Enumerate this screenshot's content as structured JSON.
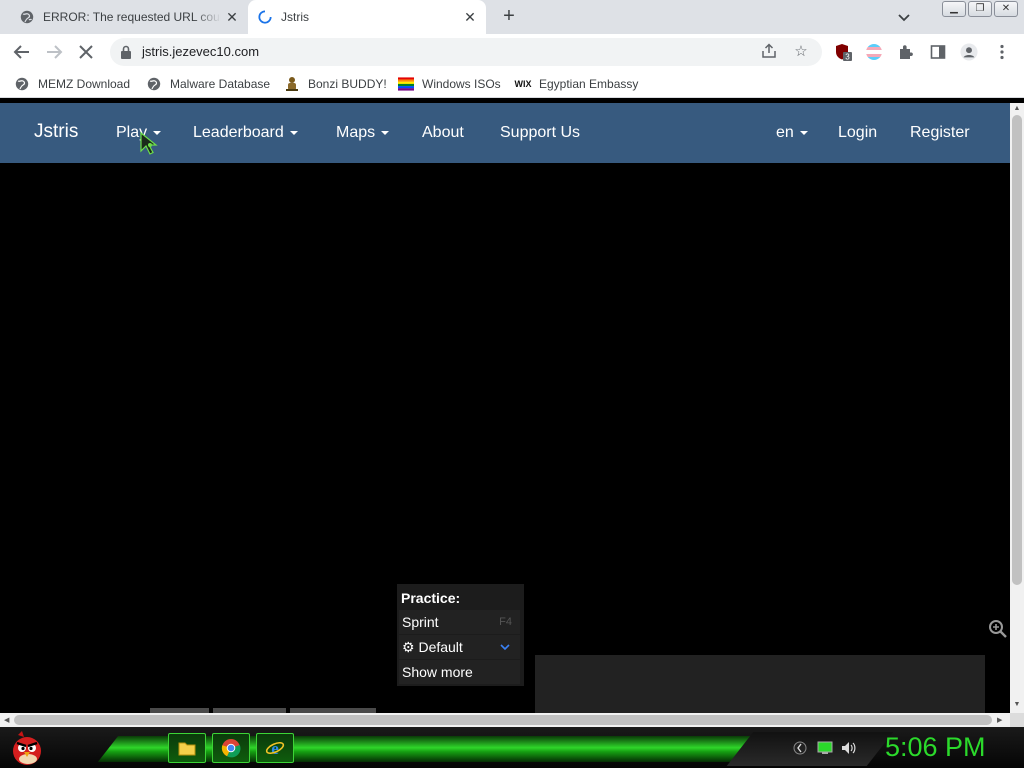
{
  "browser": {
    "tabs": [
      {
        "title": "ERROR: The requested URL could not be retrieved",
        "active": false
      },
      {
        "title": "Jstris",
        "active": true
      }
    ],
    "url": "jstris.jezevec10.com",
    "bookmarks": [
      {
        "label": "MEMZ Download",
        "icon": "globe-icon"
      },
      {
        "label": "Malware Database",
        "icon": "globe-icon"
      },
      {
        "label": "Bonzi BUDDY!",
        "icon": "bonzi-icon"
      },
      {
        "label": "Windows ISOs",
        "icon": "rainbow-flag-icon"
      },
      {
        "label": "Egyptian Embassy",
        "icon": "wix-icon"
      }
    ],
    "extension_badge": "3",
    "window_buttons": [
      "minimize",
      "restore",
      "close"
    ]
  },
  "site": {
    "brand": "Jstris",
    "nav": [
      {
        "label": "Play",
        "dropdown": true
      },
      {
        "label": "Leaderboard",
        "dropdown": true
      },
      {
        "label": "Maps",
        "dropdown": true
      },
      {
        "label": "About",
        "dropdown": false
      },
      {
        "label": "Support Us",
        "dropdown": false
      }
    ],
    "nav_right": [
      {
        "label": "en",
        "dropdown": true
      },
      {
        "label": "Login",
        "dropdown": false
      },
      {
        "label": "Register",
        "dropdown": false
      }
    ],
    "navbar_color": "#375a7f"
  },
  "practice": {
    "heading": "Practice:",
    "sprint_label": "Sprint",
    "sprint_key": "F4",
    "mode_label": "Default",
    "show_more": "Show more"
  },
  "taskbar": {
    "clock": "5:06 PM",
    "accent": "#2bd92b",
    "apps": [
      "file-explorer-icon",
      "chrome-icon",
      "internet-explorer-icon"
    ]
  }
}
